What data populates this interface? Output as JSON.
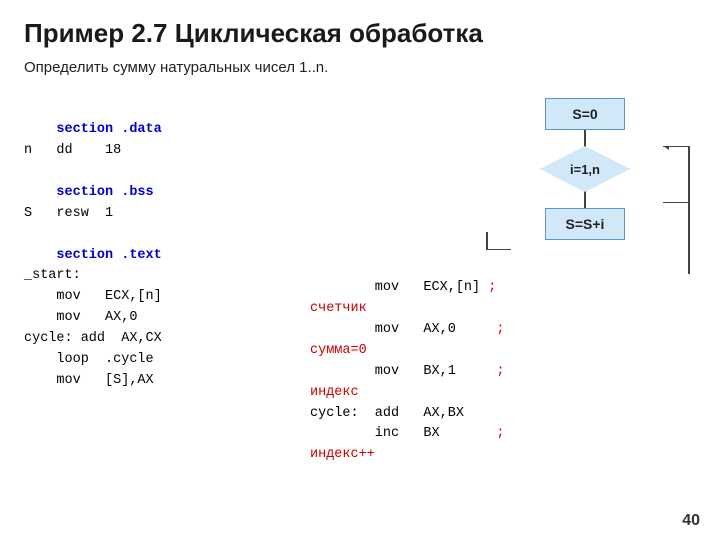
{
  "title": "Пример 2.7 Циклическая обработка",
  "subtitle": "Определить сумму натуральных чисел 1..n.",
  "left_code": {
    "line1": "    section .data",
    "line2": "n   dd    18",
    "line3": "",
    "line4": "    section .bss",
    "line5": "S   resw  1",
    "line6": "",
    "line7": "    section .text",
    "line8": "_start:",
    "line9": "    mov   ECX,[n]",
    "line10": "    mov   AX,0",
    "line11": "cycle: add  AX,CX",
    "line12": "    loop  .cycle",
    "line13": "    mov   [S],AX"
  },
  "right_code": {
    "line1": "        mov   ECX,[n]",
    "comment1": " ;",
    "comment1text": "счетчик",
    "line2": "        mov   AX,0",
    "comment2": " ;",
    "comment2text": "сумма=0",
    "line3": "        mov   BX,1",
    "comment3": " ;",
    "comment3text": "индекс",
    "line4": "cycle:  add   AX,BX",
    "line5": "        inc   BX",
    "comment5": " ;",
    "comment5text": "индекс++"
  },
  "diagram": {
    "box1": "S=0",
    "box2": "i=1,n",
    "box3": "S=S+i"
  },
  "page_number": "40"
}
